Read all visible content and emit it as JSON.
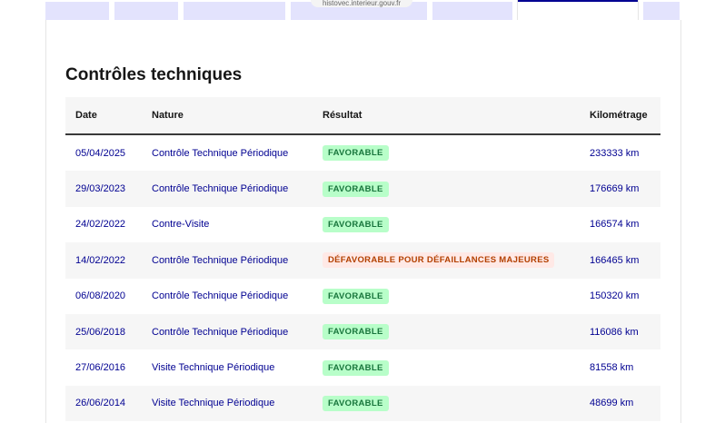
{
  "browser": {
    "url": "histovec.interieur.gouv.fr"
  },
  "tabs": [
    {
      "label": ""
    },
    {
      "label": ""
    },
    {
      "label": ""
    },
    {
      "label": ""
    },
    {
      "label": ""
    },
    {
      "label": ""
    },
    {
      "label": ""
    }
  ],
  "section": {
    "title": "Contrôles techniques"
  },
  "table": {
    "headers": {
      "date": "Date",
      "nature": "Nature",
      "result": "Résultat",
      "mileage": "Kilométrage"
    },
    "rows": [
      {
        "date": "05/04/2025",
        "nature": "Contrôle Technique Périodique",
        "result": "FAVORABLE",
        "status": "ok",
        "mileage": "233333 km"
      },
      {
        "date": "29/03/2023",
        "nature": "Contrôle Technique Périodique",
        "result": "FAVORABLE",
        "status": "ok",
        "mileage": "176669 km"
      },
      {
        "date": "24/02/2022",
        "nature": "Contre-Visite",
        "result": "FAVORABLE",
        "status": "ok",
        "mileage": "166574 km"
      },
      {
        "date": "14/02/2022",
        "nature": "Contrôle Technique Périodique",
        "result": "DÉFAVORABLE POUR DÉFAILLANCES MAJEURES",
        "status": "ko",
        "mileage": "166465 km"
      },
      {
        "date": "06/08/2020",
        "nature": "Contrôle Technique Périodique",
        "result": "FAVORABLE",
        "status": "ok",
        "mileage": "150320 km"
      },
      {
        "date": "25/06/2018",
        "nature": "Contrôle Technique Périodique",
        "result": "FAVORABLE",
        "status": "ok",
        "mileage": "116086 km"
      },
      {
        "date": "27/06/2016",
        "nature": "Visite Technique Périodique",
        "result": "FAVORABLE",
        "status": "ok",
        "mileage": "81558 km"
      },
      {
        "date": "26/06/2014",
        "nature": "Visite Technique Périodique",
        "result": "FAVORABLE",
        "status": "ok",
        "mileage": "48699 km"
      }
    ]
  },
  "colors": {
    "link_blue": "#000091",
    "ok_bg": "#b8fec9",
    "ok_text": "#18753c",
    "ko_bg": "#ffe9e6",
    "ko_text": "#b34000",
    "header_bg": "#f6f6f6"
  }
}
